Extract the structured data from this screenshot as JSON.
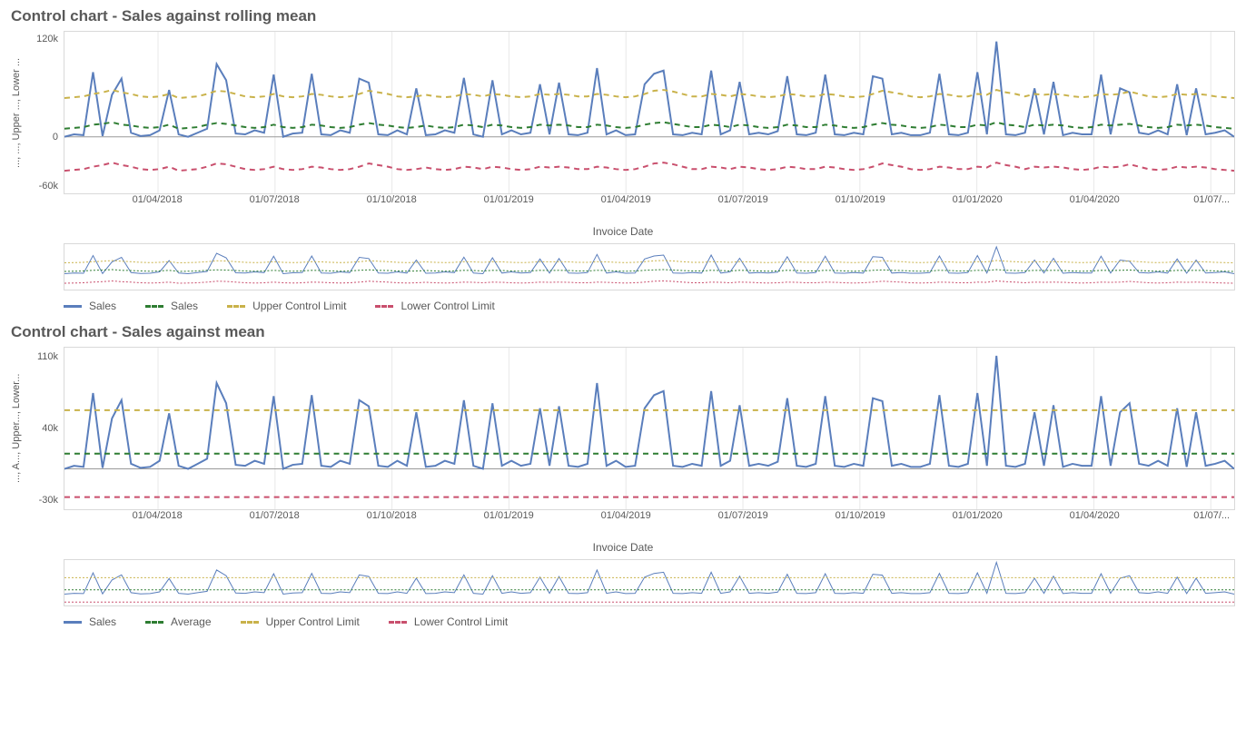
{
  "chart_data": [
    {
      "type": "line",
      "title": "Control chart - Sales against rolling mean",
      "xlabel": "Invoice Date",
      "ylabel": "..., ..., Upper ..., Lower ...",
      "ylim": [
        -70000,
        130000
      ],
      "yticks": [
        -60000,
        0,
        120000
      ],
      "ytick_labels": [
        "-60k",
        "0",
        "120k"
      ],
      "x_categories": [
        "01/04/2018",
        "01/07/2018",
        "01/10/2018",
        "01/01/2019",
        "01/04/2019",
        "01/07/2019",
        "01/10/2019",
        "01/01/2020",
        "01/04/2020",
        "01/07/..."
      ],
      "series": [
        {
          "name": "Sales",
          "style": "solid",
          "color": "#5a7ebc",
          "values": [
            0,
            3,
            2,
            80,
            1,
            52,
            72,
            5,
            1,
            2,
            8,
            58,
            3,
            0,
            5,
            10,
            90,
            70,
            4,
            3,
            8,
            5,
            77,
            0,
            4,
            5,
            78,
            3,
            2,
            8,
            5,
            72,
            67,
            3,
            2,
            8,
            3,
            60,
            2,
            3,
            8,
            5,
            73,
            3,
            0,
            70,
            3,
            8,
            3,
            5,
            65,
            3,
            67,
            3,
            2,
            5,
            85,
            3,
            8,
            2,
            3,
            65,
            78,
            82,
            3,
            2,
            5,
            3,
            82,
            3,
            8,
            68,
            3,
            5,
            3,
            7,
            75,
            3,
            2,
            5,
            77,
            3,
            2,
            5,
            3,
            75,
            72,
            3,
            5,
            2,
            2,
            5,
            78,
            3,
            2,
            5,
            80,
            3,
            118,
            3,
            2,
            5,
            60,
            3,
            68,
            2,
            5,
            3,
            3,
            77,
            3,
            60,
            55,
            5,
            3,
            8,
            3,
            65,
            2,
            60,
            3,
            5,
            8,
            0
          ]
        },
        {
          "name": "Sales",
          "style": "dashed",
          "color": "#2e7d32",
          "values": [
            10,
            11,
            12,
            15,
            16,
            18,
            15,
            14,
            12,
            11,
            12,
            15,
            10,
            11,
            12,
            15,
            17,
            16,
            14,
            12,
            11,
            12,
            15,
            12,
            11,
            12,
            15,
            14,
            12,
            11,
            12,
            15,
            17,
            15,
            14,
            12,
            11,
            12,
            14,
            12,
            11,
            12,
            15,
            14,
            12,
            15,
            14,
            12,
            11,
            12,
            15,
            14,
            15,
            14,
            12,
            12,
            15,
            14,
            12,
            11,
            12,
            15,
            17,
            18,
            16,
            14,
            12,
            12,
            15,
            14,
            12,
            15,
            14,
            12,
            11,
            12,
            15,
            14,
            12,
            12,
            15,
            14,
            12,
            11,
            12,
            15,
            17,
            15,
            14,
            12,
            11,
            12,
            15,
            14,
            12,
            12,
            15,
            14,
            18,
            15,
            14,
            12,
            15,
            14,
            15,
            14,
            12,
            11,
            12,
            15,
            14,
            15,
            16,
            14,
            12,
            11,
            12,
            15,
            14,
            15,
            14,
            12,
            11,
            10
          ]
        },
        {
          "name": "Upper Control Limit",
          "style": "dashed",
          "color": "#c9b24a",
          "values": [
            48,
            49,
            50,
            53,
            55,
            58,
            55,
            53,
            50,
            49,
            50,
            53,
            48,
            49,
            50,
            53,
            57,
            56,
            53,
            50,
            49,
            50,
            53,
            50,
            49,
            50,
            53,
            52,
            50,
            49,
            50,
            53,
            57,
            55,
            53,
            50,
            49,
            50,
            52,
            50,
            49,
            50,
            53,
            52,
            50,
            53,
            52,
            50,
            49,
            50,
            53,
            52,
            53,
            52,
            50,
            50,
            53,
            52,
            50,
            49,
            50,
            53,
            57,
            58,
            56,
            53,
            50,
            50,
            53,
            52,
            50,
            53,
            52,
            50,
            49,
            50,
            53,
            52,
            50,
            50,
            53,
            52,
            50,
            49,
            50,
            53,
            57,
            55,
            53,
            50,
            49,
            50,
            53,
            52,
            50,
            50,
            53,
            52,
            58,
            55,
            53,
            50,
            53,
            52,
            53,
            52,
            50,
            49,
            50,
            53,
            52,
            53,
            56,
            53,
            50,
            49,
            50,
            53,
            52,
            53,
            52,
            50,
            49,
            48
          ]
        },
        {
          "name": "Lower Control Limit",
          "style": "dashed",
          "color": "#c94f6d",
          "values": [
            -42,
            -41,
            -40,
            -37,
            -35,
            -32,
            -35,
            -37,
            -40,
            -41,
            -40,
            -37,
            -42,
            -41,
            -40,
            -37,
            -33,
            -34,
            -37,
            -40,
            -41,
            -40,
            -37,
            -40,
            -41,
            -40,
            -37,
            -38,
            -40,
            -41,
            -40,
            -37,
            -33,
            -35,
            -37,
            -40,
            -41,
            -40,
            -38,
            -40,
            -41,
            -40,
            -37,
            -38,
            -40,
            -37,
            -38,
            -40,
            -41,
            -40,
            -37,
            -38,
            -37,
            -38,
            -40,
            -40,
            -37,
            -38,
            -40,
            -41,
            -40,
            -37,
            -33,
            -32,
            -34,
            -37,
            -40,
            -40,
            -37,
            -38,
            -40,
            -37,
            -38,
            -40,
            -41,
            -40,
            -37,
            -38,
            -40,
            -40,
            -37,
            -38,
            -40,
            -41,
            -40,
            -37,
            -33,
            -35,
            -37,
            -40,
            -41,
            -40,
            -37,
            -38,
            -40,
            -40,
            -37,
            -38,
            -32,
            -35,
            -37,
            -40,
            -37,
            -38,
            -37,
            -38,
            -40,
            -41,
            -40,
            -37,
            -38,
            -37,
            -34,
            -37,
            -40,
            -41,
            -40,
            -37,
            -38,
            -37,
            -38,
            -40,
            -41,
            -42
          ]
        }
      ],
      "legend": [
        "Sales",
        "Sales",
        "Upper Control Limit",
        "Lower Control Limit"
      ]
    },
    {
      "type": "line",
      "title": "Control chart - Sales against mean",
      "xlabel": "Invoice Date",
      "ylabel": "..., A..., Upper..., Lower...",
      "ylim": [
        -40000,
        120000
      ],
      "yticks": [
        -30000,
        40000,
        110000
      ],
      "ytick_labels": [
        "-30k",
        "40k",
        "110k"
      ],
      "x_categories": [
        "01/04/2018",
        "01/07/2018",
        "01/10/2018",
        "01/01/2019",
        "01/04/2019",
        "01/07/2019",
        "01/10/2019",
        "01/01/2020",
        "01/04/2020",
        "01/07/..."
      ],
      "series": [
        {
          "name": "Sales",
          "style": "solid",
          "color": "#5a7ebc",
          "values": [
            0,
            3,
            2,
            75,
            1,
            50,
            68,
            5,
            1,
            2,
            8,
            55,
            3,
            0,
            5,
            10,
            85,
            65,
            4,
            3,
            8,
            5,
            72,
            0,
            4,
            5,
            73,
            3,
            2,
            8,
            5,
            68,
            62,
            3,
            2,
            8,
            3,
            56,
            2,
            3,
            8,
            5,
            68,
            3,
            0,
            65,
            3,
            8,
            3,
            5,
            60,
            3,
            62,
            3,
            2,
            5,
            85,
            3,
            8,
            2,
            3,
            60,
            73,
            77,
            3,
            2,
            5,
            3,
            77,
            3,
            8,
            63,
            3,
            5,
            3,
            7,
            70,
            3,
            2,
            5,
            72,
            3,
            2,
            5,
            3,
            70,
            67,
            3,
            5,
            2,
            2,
            5,
            73,
            3,
            2,
            5,
            75,
            3,
            112,
            3,
            2,
            5,
            56,
            3,
            63,
            2,
            5,
            3,
            3,
            72,
            3,
            56,
            65,
            5,
            3,
            8,
            3,
            60,
            2,
            56,
            3,
            5,
            8,
            0
          ]
        },
        {
          "name": "Average",
          "style": "dashed",
          "color": "#2e7d32",
          "constant": 15000
        },
        {
          "name": "Upper Control Limit",
          "style": "dashed",
          "color": "#c9b24a",
          "constant": 58000
        },
        {
          "name": "Lower Control Limit",
          "style": "dashed",
          "color": "#c94f6d",
          "constant": -28000
        }
      ],
      "legend": [
        "Sales",
        "Average",
        "Upper Control Limit",
        "Lower Control Limit"
      ]
    }
  ],
  "colors": {
    "sales": "#5a7ebc",
    "mean": "#2e7d32",
    "ucl": "#c9b24a",
    "lcl": "#c94f6d"
  }
}
